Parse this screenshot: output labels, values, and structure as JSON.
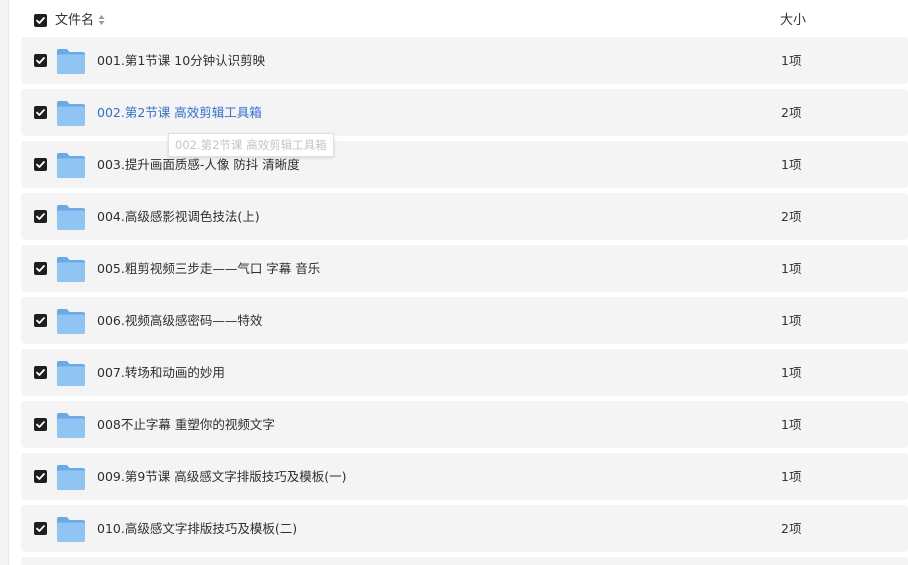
{
  "header": {
    "name_label": "文件名",
    "size_label": "大小",
    "sort_icon": "sort-updown-icon",
    "select_all_checked": true
  },
  "colors": {
    "row_bg": "#f4f4f5",
    "checkbox": "#1f1f1f",
    "folder": "#7fb8ef",
    "hover_link": "#2f6fe0"
  },
  "files": [
    {
      "name": "001.第1节课 10分钟认识剪映",
      "size": "1项",
      "checked": true,
      "hovered": false
    },
    {
      "name": "002.第2节课 高效剪辑工具箱",
      "size": "2项",
      "checked": true,
      "hovered": true
    },
    {
      "name": "003.提升画面质感-人像 防抖 清晰度",
      "size": "1项",
      "checked": true,
      "hovered": false
    },
    {
      "name": "004.高级感影视调色技法(上)",
      "size": "2项",
      "checked": true,
      "hovered": false
    },
    {
      "name": "005.粗剪视频三步走——气口 字幕 音乐",
      "size": "1项",
      "checked": true,
      "hovered": false
    },
    {
      "name": "006.视频高级感密码——特效",
      "size": "1项",
      "checked": true,
      "hovered": false
    },
    {
      "name": "007.转场和动画的妙用",
      "size": "1项",
      "checked": true,
      "hovered": false
    },
    {
      "name": "008不止字幕 重塑你的视频文字",
      "size": "1项",
      "checked": true,
      "hovered": false
    },
    {
      "name": "009.第9节课 高级感文字排版技巧及模板(一)",
      "size": "1项",
      "checked": true,
      "hovered": false
    },
    {
      "name": "010.高级感文字排版技巧及模板(二)",
      "size": "2项",
      "checked": true,
      "hovered": false
    }
  ],
  "tooltip": {
    "text": "002.第2节课 高效剪辑工具箱"
  }
}
